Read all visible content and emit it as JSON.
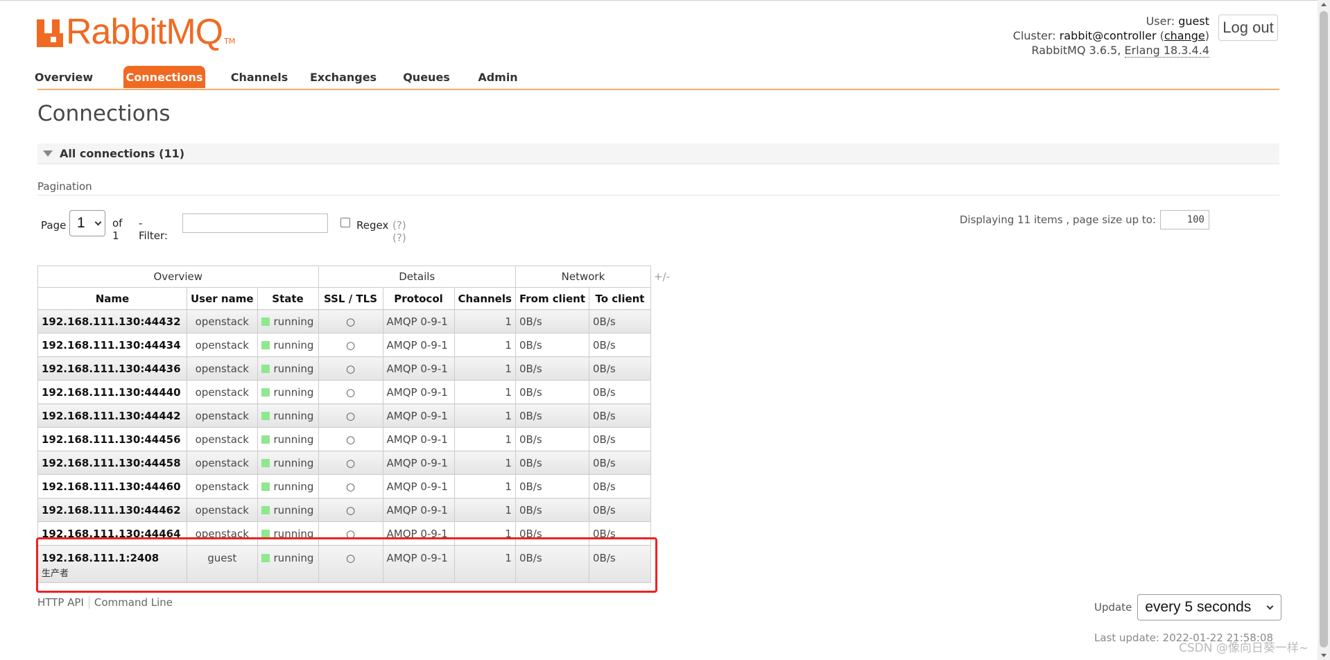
{
  "brand": {
    "name": "RabbitMQ",
    "tm": "TM",
    "color": "#f06a22"
  },
  "header": {
    "user_label": "User:",
    "user": "guest",
    "cluster_label": "Cluster:",
    "cluster": "rabbit@controller",
    "change_link": "change",
    "version": "RabbitMQ 3.6.5,",
    "erlang": "Erlang 18.3.4.4",
    "logout": "Log out"
  },
  "nav": {
    "items": [
      "Overview",
      "Connections",
      "Channels",
      "Exchanges",
      "Queues",
      "Admin"
    ],
    "active": "Connections"
  },
  "page_title": "Connections",
  "section": {
    "title": "All connections (11)"
  },
  "pagination": {
    "label": "Pagination",
    "page_label": "Page",
    "page_value": "1",
    "of_label": "of 1",
    "filter_label": "- Filter:",
    "filter_value": "",
    "regex_label": "Regex",
    "regex_help": "(?)(?)",
    "display_text": "Displaying 11 items , page size up to:",
    "page_size": "100"
  },
  "table": {
    "groups": [
      "Overview",
      "Details",
      "Network"
    ],
    "columns": [
      "Name",
      "User name",
      "State",
      "SSL / TLS",
      "Protocol",
      "Channels",
      "From client",
      "To client"
    ],
    "toggle": "+/-",
    "rows": [
      {
        "name": "192.168.111.130:44432",
        "user": "openstack",
        "state": "running",
        "ssl": "○",
        "protocol": "AMQP 0-9-1",
        "channels": "1",
        "from": "0B/s",
        "to": "0B/s"
      },
      {
        "name": "192.168.111.130:44434",
        "user": "openstack",
        "state": "running",
        "ssl": "○",
        "protocol": "AMQP 0-9-1",
        "channels": "1",
        "from": "0B/s",
        "to": "0B/s"
      },
      {
        "name": "192.168.111.130:44436",
        "user": "openstack",
        "state": "running",
        "ssl": "○",
        "protocol": "AMQP 0-9-1",
        "channels": "1",
        "from": "0B/s",
        "to": "0B/s"
      },
      {
        "name": "192.168.111.130:44440",
        "user": "openstack",
        "state": "running",
        "ssl": "○",
        "protocol": "AMQP 0-9-1",
        "channels": "1",
        "from": "0B/s",
        "to": "0B/s"
      },
      {
        "name": "192.168.111.130:44442",
        "user": "openstack",
        "state": "running",
        "ssl": "○",
        "protocol": "AMQP 0-9-1",
        "channels": "1",
        "from": "0B/s",
        "to": "0B/s"
      },
      {
        "name": "192.168.111.130:44456",
        "user": "openstack",
        "state": "running",
        "ssl": "○",
        "protocol": "AMQP 0-9-1",
        "channels": "1",
        "from": "0B/s",
        "to": "0B/s"
      },
      {
        "name": "192.168.111.130:44458",
        "user": "openstack",
        "state": "running",
        "ssl": "○",
        "protocol": "AMQP 0-9-1",
        "channels": "1",
        "from": "0B/s",
        "to": "0B/s"
      },
      {
        "name": "192.168.111.130:44460",
        "user": "openstack",
        "state": "running",
        "ssl": "○",
        "protocol": "AMQP 0-9-1",
        "channels": "1",
        "from": "0B/s",
        "to": "0B/s"
      },
      {
        "name": "192.168.111.130:44462",
        "user": "openstack",
        "state": "running",
        "ssl": "○",
        "protocol": "AMQP 0-9-1",
        "channels": "1",
        "from": "0B/s",
        "to": "0B/s"
      },
      {
        "name": "192.168.111.130:44464",
        "user": "openstack",
        "state": "running",
        "ssl": "○",
        "protocol": "AMQP 0-9-1",
        "channels": "1",
        "from": "0B/s",
        "to": "0B/s"
      },
      {
        "name": "192.168.111.1:2408",
        "subname": "生产者",
        "user": "guest",
        "state": "running",
        "ssl": "○",
        "protocol": "AMQP 0-9-1",
        "channels": "1",
        "from": "0B/s",
        "to": "0B/s"
      }
    ],
    "state_color": "#8ee88e"
  },
  "footer": {
    "http_api": "HTTP API",
    "command_line": "Command Line",
    "update_label": "Update",
    "update_value": "every 5 seconds",
    "last_update": "Last update: 2022-01-22 21:58:08"
  },
  "watermark": "CSDN @像向日葵一样~",
  "highlight_color": "#ee2222"
}
